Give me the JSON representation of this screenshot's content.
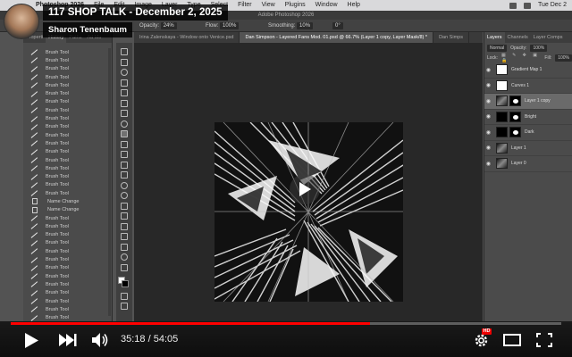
{
  "menubar": {
    "menus": [
      "Photoshop 2026",
      "File",
      "Edit",
      "Image",
      "Layer",
      "Type",
      "Select",
      "Filter",
      "View",
      "Plugins",
      "Window",
      "Help"
    ],
    "clock": "Tue Dec 2"
  },
  "app": {
    "window_title": "Adobe Photoshop 2026",
    "options": {
      "mode_value": "Normal",
      "opacity_label": "Opacity:",
      "opacity_value": "24%",
      "flow_label": "Flow:",
      "flow_value": "100%",
      "smoothing_label": "Smoothing:",
      "smoothing_value": "10%",
      "angle_value": "0°"
    }
  },
  "left_panel": {
    "tabs": [
      "Properti",
      "History",
      "Paths",
      "Ad Mo"
    ],
    "active_tab": "History",
    "history_items": [
      {
        "label": "Brush Tool",
        "icon": "brush"
      },
      {
        "label": "Brush Tool",
        "icon": "brush"
      },
      {
        "label": "Brush Tool",
        "icon": "brush"
      },
      {
        "label": "Brush Tool",
        "icon": "brush"
      },
      {
        "label": "Brush Tool",
        "icon": "brush"
      },
      {
        "label": "Brush Tool",
        "icon": "brush"
      },
      {
        "label": "Brush Tool",
        "icon": "brush"
      },
      {
        "label": "Brush Tool",
        "icon": "brush"
      },
      {
        "label": "Brush Tool",
        "icon": "brush"
      },
      {
        "label": "Brush Tool",
        "icon": "brush"
      },
      {
        "label": "Brush Tool",
        "icon": "brush"
      },
      {
        "label": "Brush Tool",
        "icon": "brush"
      },
      {
        "label": "Brush Tool",
        "icon": "brush"
      },
      {
        "label": "Brush Tool",
        "icon": "brush"
      },
      {
        "label": "Brush Tool",
        "icon": "brush"
      },
      {
        "label": "Brush Tool",
        "icon": "brush"
      },
      {
        "label": "Brush Tool",
        "icon": "brush"
      },
      {
        "label": "Brush Tool",
        "icon": "brush"
      },
      {
        "label": "Name Change",
        "icon": "doc"
      },
      {
        "label": "Name Change",
        "icon": "doc"
      },
      {
        "label": "Brush Tool",
        "icon": "brush"
      },
      {
        "label": "Brush Tool",
        "icon": "brush"
      },
      {
        "label": "Brush Tool",
        "icon": "brush"
      },
      {
        "label": "Brush Tool",
        "icon": "brush"
      },
      {
        "label": "Brush Tool",
        "icon": "brush"
      },
      {
        "label": "Brush Tool",
        "icon": "brush"
      },
      {
        "label": "Brush Tool",
        "icon": "brush"
      },
      {
        "label": "Brush Tool",
        "icon": "brush"
      },
      {
        "label": "Brush Tool",
        "icon": "brush"
      },
      {
        "label": "Brush Tool",
        "icon": "brush"
      },
      {
        "label": "Brush Tool",
        "icon": "brush"
      },
      {
        "label": "Brush Tool",
        "icon": "brush"
      },
      {
        "label": "Brush Tool",
        "icon": "brush"
      }
    ]
  },
  "doc_tabs": [
    {
      "label": "Irina Zalenskaya - Window onto Venice.psd",
      "active": false
    },
    {
      "label": "Dan Simpson - Layered Fans Mod. 01.psd @ 66.7% (Layer 1 copy, Layer Mask/8) *",
      "active": true
    },
    {
      "label": "Dan Simps",
      "active": false
    }
  ],
  "right_panel": {
    "tabs": [
      "Layers",
      "Channels",
      "Layer Comps"
    ],
    "active_tab": "Layers",
    "blend_mode": "Normal",
    "opacity_label": "Opacity:",
    "opacity_value": "100%",
    "lock_label": "Lock:",
    "fill_label": "Fill:",
    "fill_value": "100%",
    "layers": [
      {
        "name": "Gradient Map 1",
        "thumb": "white",
        "mask": false,
        "selected": false
      },
      {
        "name": "Curves 1",
        "thumb": "white",
        "mask": false,
        "selected": false
      },
      {
        "name": "Layer 1 copy",
        "thumb": "dark",
        "mask": true,
        "selected": true
      },
      {
        "name": "Bright",
        "thumb": "black",
        "mask": true,
        "selected": false
      },
      {
        "name": "Dark",
        "thumb": "black",
        "mask": true,
        "selected": false
      },
      {
        "name": "Layer 1",
        "thumb": "dark",
        "mask": false,
        "selected": false
      },
      {
        "name": "Layer 0",
        "thumb": "dark",
        "mask": false,
        "selected": false
      }
    ]
  },
  "video": {
    "title": "117 SHOP TALK - December 2, 2025",
    "channel": "Sharon Tenenbaum",
    "current_time": "35:18",
    "duration": "54:05",
    "time_separator": " / ",
    "progress_fraction": 0.6527,
    "quality_badge": "HD",
    "accent_color": "#ff0000"
  }
}
